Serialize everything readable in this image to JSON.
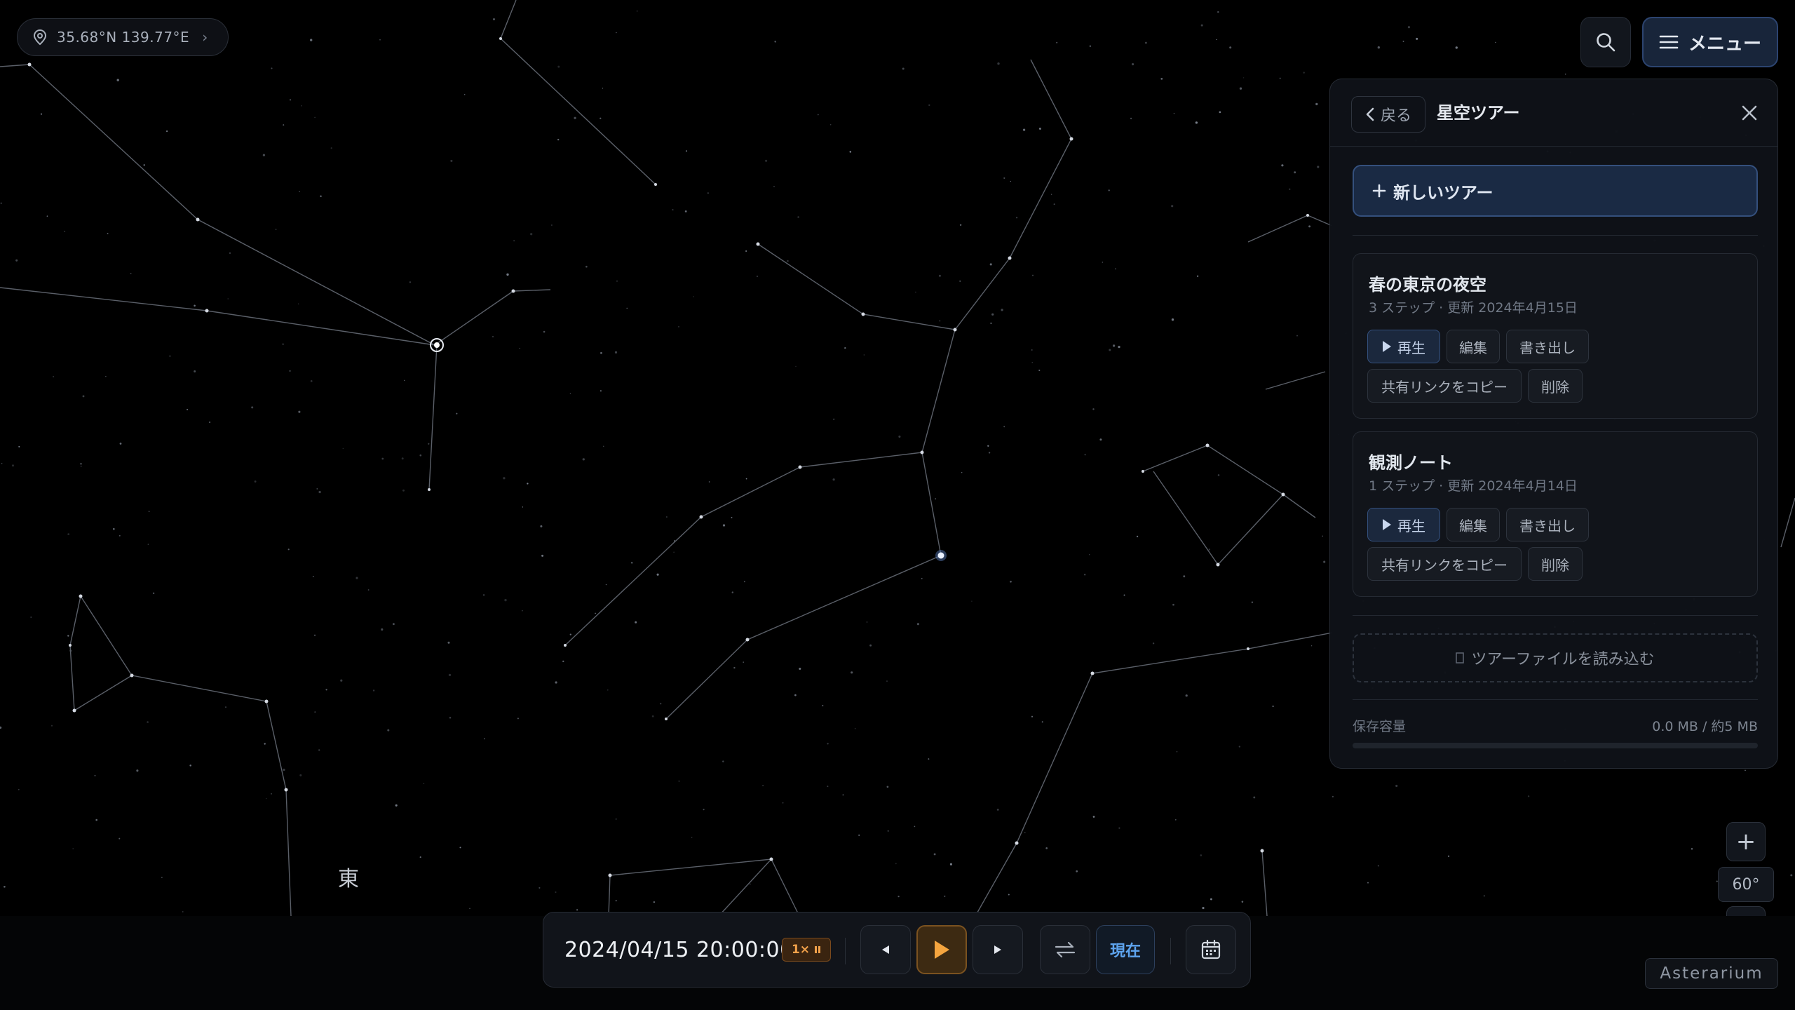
{
  "location": {
    "coords": "35.68°N 139.77°E",
    "chevron": "›"
  },
  "header": {
    "menu_label": "メニュー"
  },
  "panel": {
    "back_label": "戻る",
    "title": "星空ツアー",
    "new_tour_label": "新しいツアー",
    "tours": [
      {
        "title": "春の東京の夜空",
        "meta": "3 ステップ · 更新 2024年4月15日",
        "play": "再生",
        "edit": "編集",
        "export": "書き出し",
        "share": "共有リンクをコピー",
        "delete": "削除"
      },
      {
        "title": "観測ノート",
        "meta": "1 ステップ · 更新 2024年4月14日",
        "play": "再生",
        "edit": "編集",
        "export": "書き出し",
        "share": "共有リンクをコピー",
        "delete": "削除"
      }
    ],
    "import_label": "ツアーファイルを読み込む",
    "storage_label": "保存容量",
    "storage_value": "0.0 MB / 約5 MB",
    "storage_fraction": 0.0
  },
  "zoom": {
    "plus": "+",
    "minus": "−",
    "fov": "60°"
  },
  "brand": "Asterarium",
  "compass": {
    "direction": "東"
  },
  "timebar": {
    "datetime": "2024/04/15 20:00:00",
    "speed": "1×",
    "now_label": "現在"
  },
  "colors": {
    "accent": "#34507d",
    "play_accent": "#f2a14a",
    "now_blue": "#5ea4ee",
    "background": "#000000"
  }
}
